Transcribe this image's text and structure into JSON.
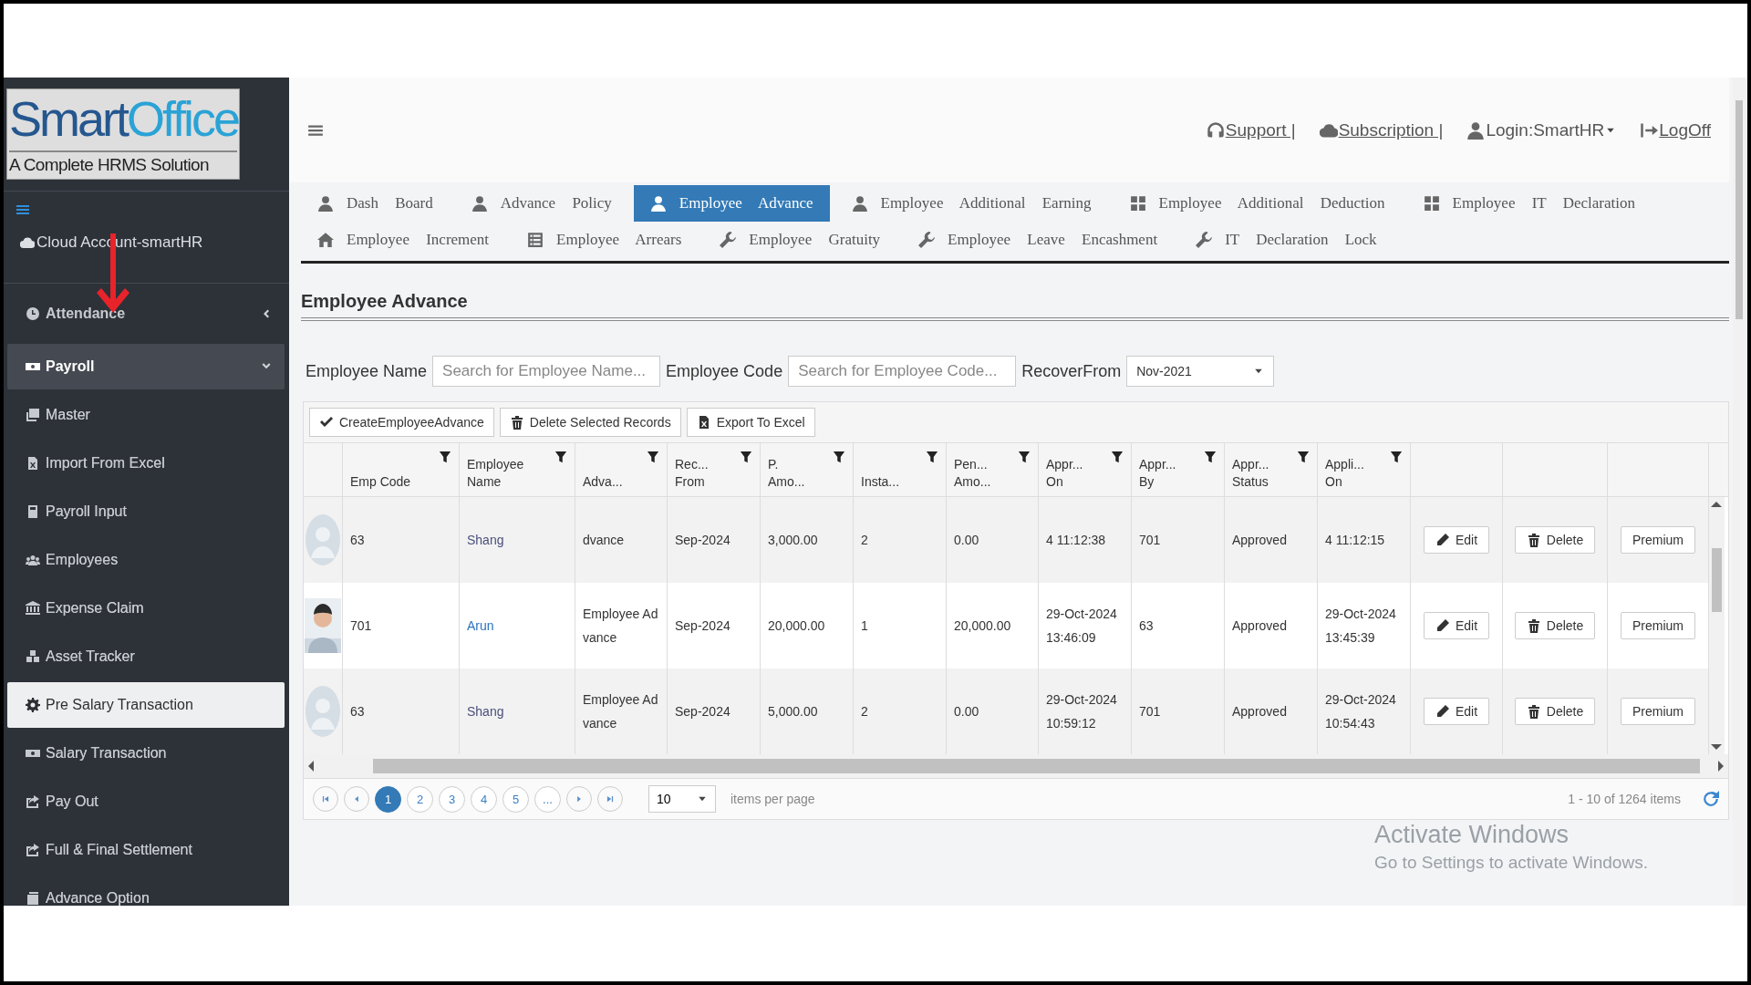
{
  "logo": {
    "brand_a": "Smart",
    "brand_b": "Office",
    "tagline": "A Complete HRMS Solution"
  },
  "account": "Cloud Account-smartHR",
  "sidebar": {
    "items": [
      {
        "label": "Attendance",
        "expanded": false
      },
      {
        "label": "Payroll",
        "expanded": true,
        "children": [
          {
            "label": "Master",
            "selected": false
          },
          {
            "label": "Import From Excel",
            "selected": false
          },
          {
            "label": "Payroll Input",
            "selected": false
          },
          {
            "label": "Employees",
            "selected": false
          },
          {
            "label": "Expense Claim",
            "selected": false
          },
          {
            "label": "Asset Tracker",
            "selected": false
          },
          {
            "label": "Pre Salary Transaction",
            "selected": true
          },
          {
            "label": "Salary Transaction",
            "selected": false
          },
          {
            "label": "Pay Out",
            "selected": false
          },
          {
            "label": "Full & Final Settlement",
            "selected": false
          },
          {
            "label": "Advance Option",
            "selected": false
          }
        ]
      }
    ]
  },
  "header": {
    "links": [
      {
        "label": "Support |",
        "kind": "link"
      },
      {
        "label": "Subscription |",
        "kind": "link"
      },
      {
        "label": "Login:SmartHR",
        "kind": "menu"
      },
      {
        "label": "LogOff",
        "kind": "link"
      }
    ]
  },
  "tabs": [
    {
      "label": "Dash Board",
      "selected": false
    },
    {
      "label": "Advance Policy",
      "selected": false
    },
    {
      "label": "Employee Advance",
      "selected": true
    },
    {
      "label": "Employee Additional Earning",
      "selected": false
    },
    {
      "label": "Employee Additional Deduction",
      "selected": false
    },
    {
      "label": "Employee IT Declaration",
      "selected": false
    },
    {
      "label": "Employee Increment",
      "selected": false
    },
    {
      "label": "Employee Arrears",
      "selected": false
    },
    {
      "label": "Employee Gratuity",
      "selected": false
    },
    {
      "label": "Employee Leave Encashment",
      "selected": false
    },
    {
      "label": "IT Declaration Lock",
      "selected": false
    }
  ],
  "page_title": "Employee Advance",
  "filters": {
    "name_label": "Employee Name",
    "name_placeholder": "Search for Employee Name...",
    "code_label": "Employee Code",
    "code_placeholder": "Search for Employee Code...",
    "recover_label": "RecoverFrom",
    "recover_value": "Nov-2021"
  },
  "toolbar": [
    "CreateEmployeeAdvance",
    "Delete Selected Records",
    "Export To Excel"
  ],
  "table": {
    "columns": [
      "Emp Code",
      "Employee\nName",
      "Adva...",
      "Rec...\nFrom",
      "P.\nAmo...",
      "Insta...",
      "Pen...\nAmo...",
      "Appr...\nOn",
      "Appr...\nBy",
      "Appr...\nStatus",
      "Appli...\nOn"
    ],
    "rows": [
      {
        "kind": "blank",
        "visited": true,
        "cells": [
          "63",
          "Shang",
          "dvance",
          "Sep-2024",
          "3,000.00",
          "2",
          "0.00",
          "4 11:12:38",
          "701",
          "Approved",
          "4 11:12:15"
        ],
        "actions": [
          "Edit",
          "Delete",
          "Premium"
        ]
      },
      {
        "visited": false,
        "cells": [
          "701",
          "Arun",
          "Employee Advance",
          "Sep-2024",
          "20,000.00",
          "1",
          "20,000.00",
          "29-Oct-2024 13:46:09",
          "63",
          "Approved",
          "29-Oct-2024 13:45:39"
        ],
        "actions": [
          "Edit",
          "Delete",
          "Premium"
        ]
      },
      {
        "kind": "blank",
        "visited": true,
        "cells": [
          "63",
          "Shang",
          "Employee Advance",
          "Sep-2024",
          "5,000.00",
          "2",
          "0.00",
          "29-Oct-2024 10:59:12",
          "701",
          "Approved",
          "29-Oct-2024 10:54:43"
        ],
        "actions": [
          "Edit",
          "Delete",
          "Premium"
        ]
      }
    ]
  },
  "pager": {
    "pages": [
      {
        "label": "1",
        "selected": true
      },
      {
        "label": "2",
        "selected": false
      },
      {
        "label": "3",
        "selected": false
      },
      {
        "label": "4",
        "selected": false
      },
      {
        "label": "5",
        "selected": false
      },
      {
        "label": "...",
        "selected": false
      }
    ],
    "page_size": "10",
    "per_page_label": "items per page",
    "summary": "1 - 10 of 1264 items"
  },
  "os_notice": {
    "title": "Activate Windows",
    "text": "Go to Settings to activate Windows."
  }
}
